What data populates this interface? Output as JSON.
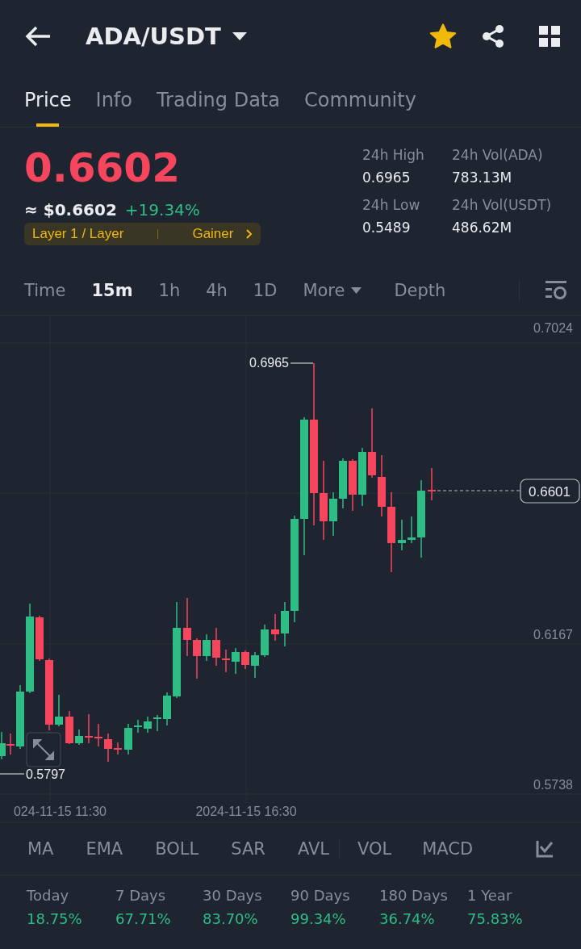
{
  "header": {
    "pair": "ADA/USDT",
    "favorite": true
  },
  "tabs": [
    {
      "label": "Price",
      "selected": true
    },
    {
      "label": "Info",
      "selected": false
    },
    {
      "label": "Trading Data",
      "selected": false
    },
    {
      "label": "Community",
      "selected": false
    }
  ],
  "price": {
    "last": "0.6602",
    "usd": "≈ $0.6602",
    "change": "+19.34%",
    "tags": [
      "Layer 1 / Layer",
      "Gainer"
    ]
  },
  "stats": [
    {
      "label": "24h High",
      "value": "0.6965"
    },
    {
      "label": "24h Vol(ADA)",
      "value": "783.13M"
    },
    {
      "label": "24h Low",
      "value": "0.5489"
    },
    {
      "label": "24h Vol(USDT)",
      "value": "486.62M"
    }
  ],
  "intervals": [
    {
      "label": "Time",
      "selected": false,
      "kind": "plain"
    },
    {
      "label": "15m",
      "selected": true,
      "kind": "plain"
    },
    {
      "label": "1h",
      "selected": false,
      "kind": "plain"
    },
    {
      "label": "4h",
      "selected": false,
      "kind": "plain"
    },
    {
      "label": "1D",
      "selected": false,
      "kind": "plain"
    },
    {
      "label": "More",
      "selected": false,
      "kind": "dropdown"
    },
    {
      "label": "Depth",
      "selected": false,
      "kind": "plain"
    }
  ],
  "chart": {
    "y_labels": [
      "0.7024",
      "0.6167",
      "0.5738"
    ],
    "high_marker": "0.6965",
    "low_marker": "0.5797",
    "last_price": "0.6601",
    "x_labels": [
      "024-11-15 11:30",
      "2024-11-15 16:30"
    ]
  },
  "indicators": [
    {
      "label": "MA",
      "kind": "main"
    },
    {
      "label": "EMA",
      "kind": "main"
    },
    {
      "label": "BOLL",
      "kind": "main"
    },
    {
      "label": "SAR",
      "kind": "main"
    },
    {
      "label": "AVL",
      "kind": "main"
    },
    {
      "label": "VOL",
      "kind": "sub"
    },
    {
      "label": "MACD",
      "kind": "sub"
    }
  ],
  "performance": [
    {
      "period": "Today",
      "change": "18.75%"
    },
    {
      "period": "7 Days",
      "change": "67.71%"
    },
    {
      "period": "30 Days",
      "change": "83.70%"
    },
    {
      "period": "90 Days",
      "change": "99.34%"
    },
    {
      "period": "180 Days",
      "change": "36.74%"
    },
    {
      "period": "1 Year",
      "change": "75.83%"
    }
  ]
}
